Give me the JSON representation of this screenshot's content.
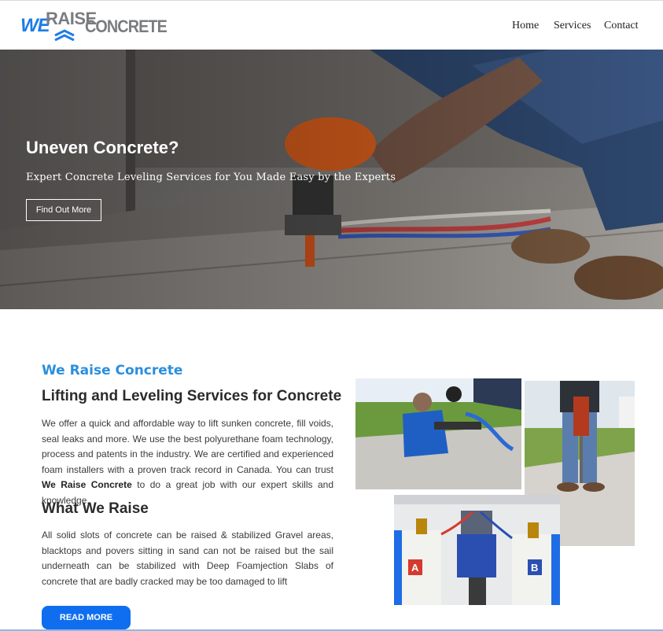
{
  "brand": {
    "logo_we": "WE",
    "logo_raise": "RAISE",
    "logo_concrete": "CONCRETE",
    "blue": "#1e7de6",
    "gray": "#7a7d80",
    "accent": "#2a8fde",
    "button_blue": "#0f6ef0"
  },
  "nav": {
    "home": "Home",
    "services": "Services",
    "contact": "Contact"
  },
  "hero": {
    "title": "Uneven Concrete?",
    "subtitle": "Expert Concrete Leveling Services for You Made Easy by the Experts",
    "button": "Find Out More"
  },
  "about": {
    "kicker": "We Raise Concrete",
    "heading": "Lifting and Leveling Services for Concrete",
    "paragraph_pre": "We offer a quick and affordable way to lift sunken concrete, fill voids, seal leaks and more. We use the best polyurethane foam technology, process and patents in the industry. We are certified and experienced foam installers with a proven track record in Canada. You can trust ",
    "paragraph_bold": "We Raise Concrete",
    "paragraph_post": " to do a great job with our expert skills and knowledge.",
    "heading2": "What We Raise",
    "paragraph2": "All solid slots of concrete can be raised & stabilized Gravel areas, blacktops and povers sitting in sand can not be raised but the sail underneath can be stabilized with Deep Foamjection Slabs of concrete that are badly cracked may be too damaged to lift",
    "button": "READ MORE"
  },
  "barrel_labels": {
    "a": "A",
    "b": "B"
  }
}
